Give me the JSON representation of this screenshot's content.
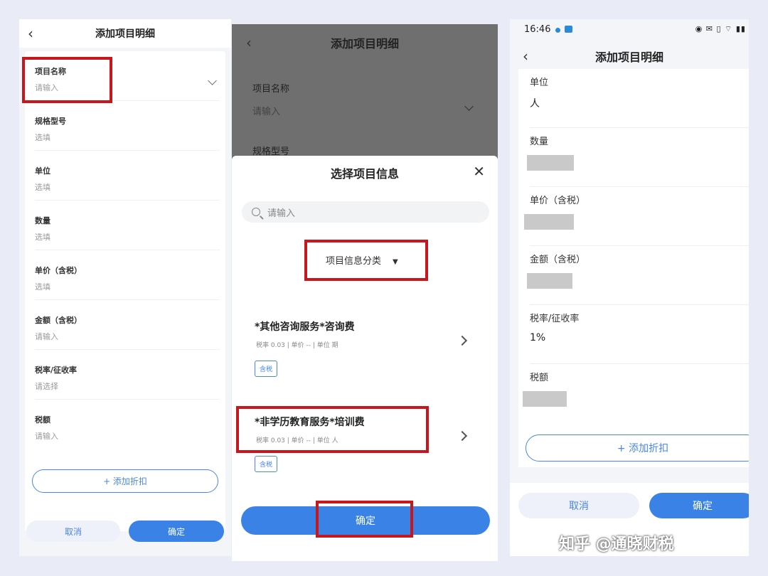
{
  "panel1": {
    "title": "添加项目明细",
    "fields": [
      {
        "label": "项目名称",
        "value": "请输入"
      },
      {
        "label": "规格型号",
        "value": "选填"
      },
      {
        "label": "单位",
        "value": "选填"
      },
      {
        "label": "数量",
        "value": "选填"
      },
      {
        "label": "单价（含税）",
        "value": "选填"
      },
      {
        "label": "金额（含税）",
        "value": "请输入"
      },
      {
        "label": "税率/征收率",
        "value": "请选择"
      },
      {
        "label": "税额",
        "value": "请输入"
      }
    ],
    "add_discount": "+ 添加折扣",
    "cancel": "取消",
    "confirm": "确定"
  },
  "panel2": {
    "title": "添加项目明细",
    "bg_fields": [
      {
        "label": "项目名称",
        "value": "请输入"
      },
      {
        "label": "规格型号",
        "value": ""
      }
    ],
    "sheet_title": "选择项目信息",
    "search_placeholder": "请输入",
    "category_filter": "项目信息分类",
    "items": [
      {
        "name": "*其他咨询服务*咨询费",
        "meta": "税率 0.03 | 单价 -- | 单位 期",
        "tag": "含税"
      },
      {
        "name": "*非学历教育服务*培训费",
        "meta": "税率 0.03 | 单价 -- | 单位 人",
        "tag": "含税"
      }
    ],
    "confirm": "确定"
  },
  "panel3": {
    "status_time": "16:46",
    "status_icons": "◉ ✉ ▯ ⌔ ▮▮",
    "title": "添加项目明细",
    "fields": [
      {
        "label": "单位",
        "value": "人"
      },
      {
        "label": "数量",
        "value": ""
      },
      {
        "label": "单价（含税）",
        "value": ""
      },
      {
        "label": "金额（含税）",
        "value": ""
      },
      {
        "label": "税率/征收率",
        "value": "1%"
      },
      {
        "label": "税额",
        "value": ""
      }
    ],
    "add_discount": "+ 添加折扣",
    "cancel": "取消",
    "confirm": "确定"
  },
  "watermark": "知乎 @通晓财税",
  "colors": {
    "accent": "#3b82e6",
    "highlight": "#c8161d"
  }
}
